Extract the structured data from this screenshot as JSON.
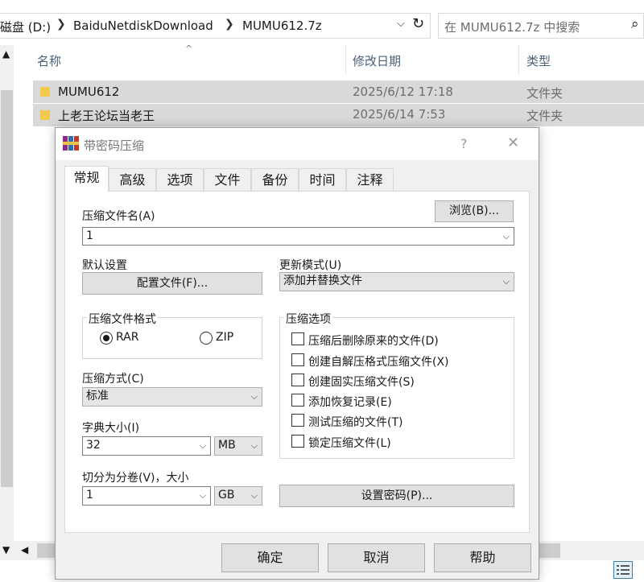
{
  "explorer": {
    "breadcrumb": [
      "磁盘 (D:)",
      "BaiduNetdiskDownload",
      "MUMU612.7z"
    ],
    "search_placeholder": "在 MUMU612.7z 中搜索",
    "columns": {
      "name": "名称",
      "date": "修改日期",
      "type": "类型"
    },
    "files": [
      {
        "name": "MUMU612",
        "date": "2025/6/12 17:18",
        "type": "文件夹"
      },
      {
        "name": "上老王论坛当老王",
        "date": "2025/6/14 7:53",
        "type": "文件夹"
      }
    ]
  },
  "dialog": {
    "title": "带密码压缩",
    "help_symbol": "?",
    "close_symbol": "✕",
    "tabs": [
      "常规",
      "高级",
      "选项",
      "文件",
      "备份",
      "时间",
      "注释"
    ],
    "archive_name_label": "压缩文件名(A)",
    "browse_button": "浏览(B)...",
    "archive_name_value": "1",
    "default_settings_label": "默认设置",
    "profiles_button": "配置文件(F)...",
    "update_mode_label": "更新模式(U)",
    "update_mode_value": "添加并替换文件",
    "archive_format_label": "压缩文件格式",
    "format_rar": "RAR",
    "format_zip": "ZIP",
    "archive_options_label": "压缩选项",
    "options": [
      "压缩后删除原来的文件(D)",
      "创建自解压格式压缩文件(X)",
      "创建固实压缩文件(S)",
      "添加恢复记录(E)",
      "测试压缩的文件(T)",
      "锁定压缩文件(L)"
    ],
    "method_label": "压缩方式(C)",
    "method_value": "标准",
    "dict_label": "字典大小(I)",
    "dict_value": "32",
    "dict_unit": "MB",
    "split_label": "切分为分卷(V)，大小",
    "split_value": "1",
    "split_unit": "GB",
    "set_password_button": "设置密码(P)...",
    "ok_button": "确定",
    "cancel_button": "取消",
    "help_button": "帮助"
  },
  "colors": {
    "selection": "#d9d9d9",
    "folder": "#f2c94c",
    "header_text": "#4c607a"
  }
}
